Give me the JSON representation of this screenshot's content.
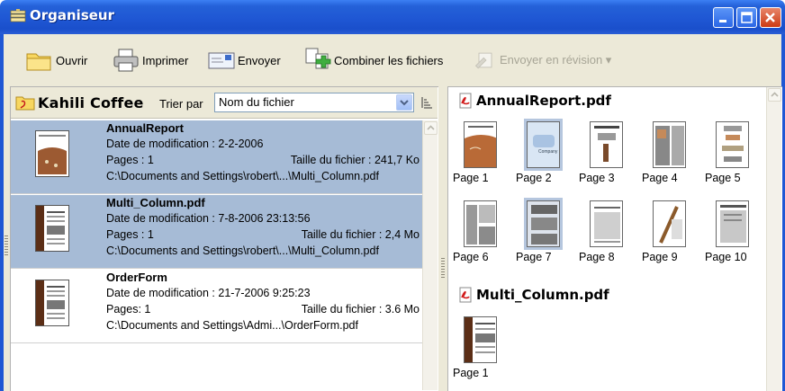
{
  "window": {
    "title": "Organiseur"
  },
  "toolbar": {
    "open_label": "Ouvrir",
    "print_label": "Imprimer",
    "send_label": "Envoyer",
    "combine_label": "Combiner les fichiers",
    "review_label": "Envoyer en révision ▾"
  },
  "left_pane": {
    "folder_name": "Kahili Coffee",
    "sort_label": "Trier par",
    "sort_value": "Nom du fichier",
    "files": [
      {
        "name": "AnnualReport",
        "date": "Date de modification : 2-2-2006",
        "pages": "Pages : 1",
        "size": "Taille du fichier : 241,7 Ko",
        "path": "C:\\Documents and Settings\\robert\\...\\Multi_Column.pdf",
        "selected": true
      },
      {
        "name": "Multi_Column.pdf",
        "date": "Date de modification : 7-8-2006 23:13:56",
        "pages": "Pages : 1",
        "size": "Taille du fichier : 2,4 Mo",
        "path": "C:\\Documents and Settings\\robert\\...\\Multi_Column.pdf",
        "selected": true
      },
      {
        "name": "OrderForm",
        "date": "Date de modification : 21-7-2006 9:25:23",
        "pages": "Pages: 1",
        "size": "Taille du fichier : 3.6 Mo",
        "path": "C:\\Documents and Settings\\Admi...\\OrderForm.pdf",
        "selected": false
      }
    ]
  },
  "right_pane": {
    "documents": [
      {
        "title": "AnnualReport.pdf",
        "pages": [
          "Page 1",
          "Page 2",
          "Page 3",
          "Page 4",
          "Page 5",
          "Page 6",
          "Page 7",
          "Page 8",
          "Page 9",
          "Page 10"
        ]
      },
      {
        "title": "Multi_Column.pdf",
        "pages": [
          "Page 1"
        ]
      }
    ]
  },
  "colors": {
    "titlebar": "#1f57d4",
    "chrome": "#ece9d8",
    "selection": "#a6bbd6"
  }
}
